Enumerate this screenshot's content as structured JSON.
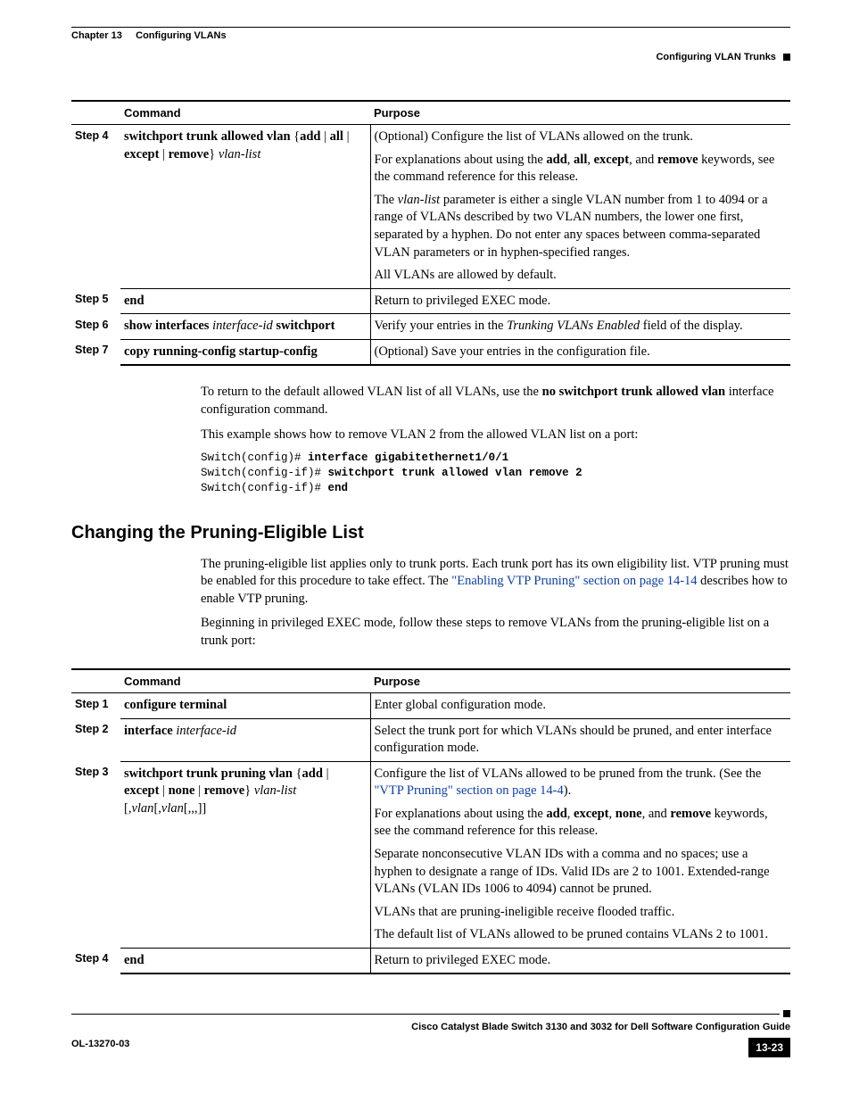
{
  "header": {
    "chapter_prefix": "Chapter 13",
    "chapter_title": "Configuring VLANs",
    "section_title": "Configuring VLAN Trunks"
  },
  "table1": {
    "headers": {
      "command": "Command",
      "purpose": "Purpose"
    },
    "rows": [
      {
        "step": "Step 4",
        "cmd_parts": {
          "a": "switchport trunk allowed vlan",
          "b": " {",
          "c": "add",
          "d": " | ",
          "e": "all",
          "f": " | ",
          "g": "except",
          "h": " | ",
          "i": "remove",
          "j": "}  ",
          "k": "vlan-list"
        },
        "purpose": {
          "p1": "(Optional) Configure the list of VLANs allowed on the trunk.",
          "p2a": "For explanations about using the ",
          "p2b": "add",
          "p2c": ", ",
          "p2d": "all",
          "p2e": ", ",
          "p2f": "except",
          "p2g": ", and ",
          "p2h": "remove",
          "p2i": " keywords, see the command reference for this release.",
          "p3a": "The ",
          "p3b": "vlan-list",
          "p3c": " parameter is either a single VLAN number from 1 to 4094 or a range of VLANs described by two VLAN numbers, the lower one first, separated by a hyphen. Do not enter any spaces between comma-separated VLAN parameters or in hyphen-specified ranges.",
          "p4": "All VLANs are allowed by default."
        }
      },
      {
        "step": "Step 5",
        "cmd_parts": {
          "a": "end"
        },
        "purpose": {
          "p1": "Return to privileged EXEC mode."
        }
      },
      {
        "step": "Step 6",
        "cmd_parts": {
          "a": "show interfaces ",
          "b": "interface-id ",
          "c": "switchport"
        },
        "purpose": {
          "p1a": "Verify your entries in the ",
          "p1b": "Trunking VLANs Enabled",
          "p1c": " field of the display."
        }
      },
      {
        "step": "Step 7",
        "cmd_parts": {
          "a": "copy running-config startup-config"
        },
        "purpose": {
          "p1": "(Optional) Save your entries in the configuration file."
        }
      }
    ]
  },
  "mid": {
    "p1a": "To return to the default allowed VLAN list of all VLANs, use the ",
    "p1b": "no switchport trunk allowed vlan",
    "p1c": " interface configuration command.",
    "p2": "This example shows how to remove VLAN 2 from the allowed VLAN list on a port:",
    "cli": {
      "l1a": "Switch(config)# ",
      "l1b": "interface gigabitethernet1/0/1",
      "l2a": "Switch(config-if)# ",
      "l2b": "switchport trunk allowed vlan remove 2",
      "l3a": "Switch(config-if)# ",
      "l3b": "end"
    }
  },
  "heading2": "Changing the Pruning-Eligible List",
  "after_heading": {
    "p1a": "The pruning-eligible list applies only to trunk ports. Each trunk port has its own eligibility list. VTP pruning must be enabled for this procedure to take effect. The ",
    "p1link": "\"Enabling VTP Pruning\" section on page 14-14",
    "p1b": " describes how to enable VTP pruning.",
    "p2": "Beginning in privileged EXEC mode, follow these steps to remove VLANs from the pruning-eligible list on a trunk port:"
  },
  "table2": {
    "headers": {
      "command": "Command",
      "purpose": "Purpose"
    },
    "rows": [
      {
        "step": "Step 1",
        "cmd_parts": {
          "a": "configure terminal"
        },
        "purpose": {
          "p1": "Enter global configuration mode."
        }
      },
      {
        "step": "Step 2",
        "cmd_parts": {
          "a": "interface ",
          "b": "interface-id"
        },
        "purpose": {
          "p1": "Select the trunk port for which VLANs should be pruned, and enter interface configuration mode."
        }
      },
      {
        "step": "Step 3",
        "cmd_parts": {
          "a": "switchport trunk pruning vlan",
          "b": " {",
          "c": "add",
          "d": " | ",
          "e": "except",
          "f": " | ",
          "g": "none",
          "h": " | ",
          "i": "remove",
          "j": "}  ",
          "k": "vlan-list",
          "l": " [,",
          "m": "vlan",
          "n": "[,",
          "o": "vlan",
          "p": "[,,,]]"
        },
        "purpose": {
          "p1a": "Configure the list of VLANs allowed to be pruned from the trunk. (See the ",
          "p1link": "\"VTP Pruning\" section on page 14-4",
          "p1b": ").",
          "p2a": "For explanations about using the ",
          "p2b": "add",
          "p2c": ", ",
          "p2d": "except",
          "p2e": ", ",
          "p2f": "none",
          "p2g": ", and ",
          "p2h": "remove",
          "p2i": " keywords, see the command reference for this release.",
          "p3": "Separate nonconsecutive VLAN IDs with a comma and no spaces; use a hyphen to designate a range of IDs. Valid IDs are 2 to 1001. Extended-range VLANs (VLAN IDs 1006 to 4094) cannot be pruned.",
          "p4": "VLANs that are pruning-ineligible receive flooded traffic.",
          "p5": "The default list of VLANs allowed to be pruned contains VLANs 2 to 1001."
        }
      },
      {
        "step": "Step 4",
        "cmd_parts": {
          "a": "end"
        },
        "purpose": {
          "p1": "Return to privileged EXEC mode."
        }
      }
    ]
  },
  "footer": {
    "book_title": "Cisco Catalyst Blade Switch 3130 and 3032 for Dell Software Configuration Guide",
    "doc_id": "OL-13270-03",
    "page": "13-23"
  }
}
